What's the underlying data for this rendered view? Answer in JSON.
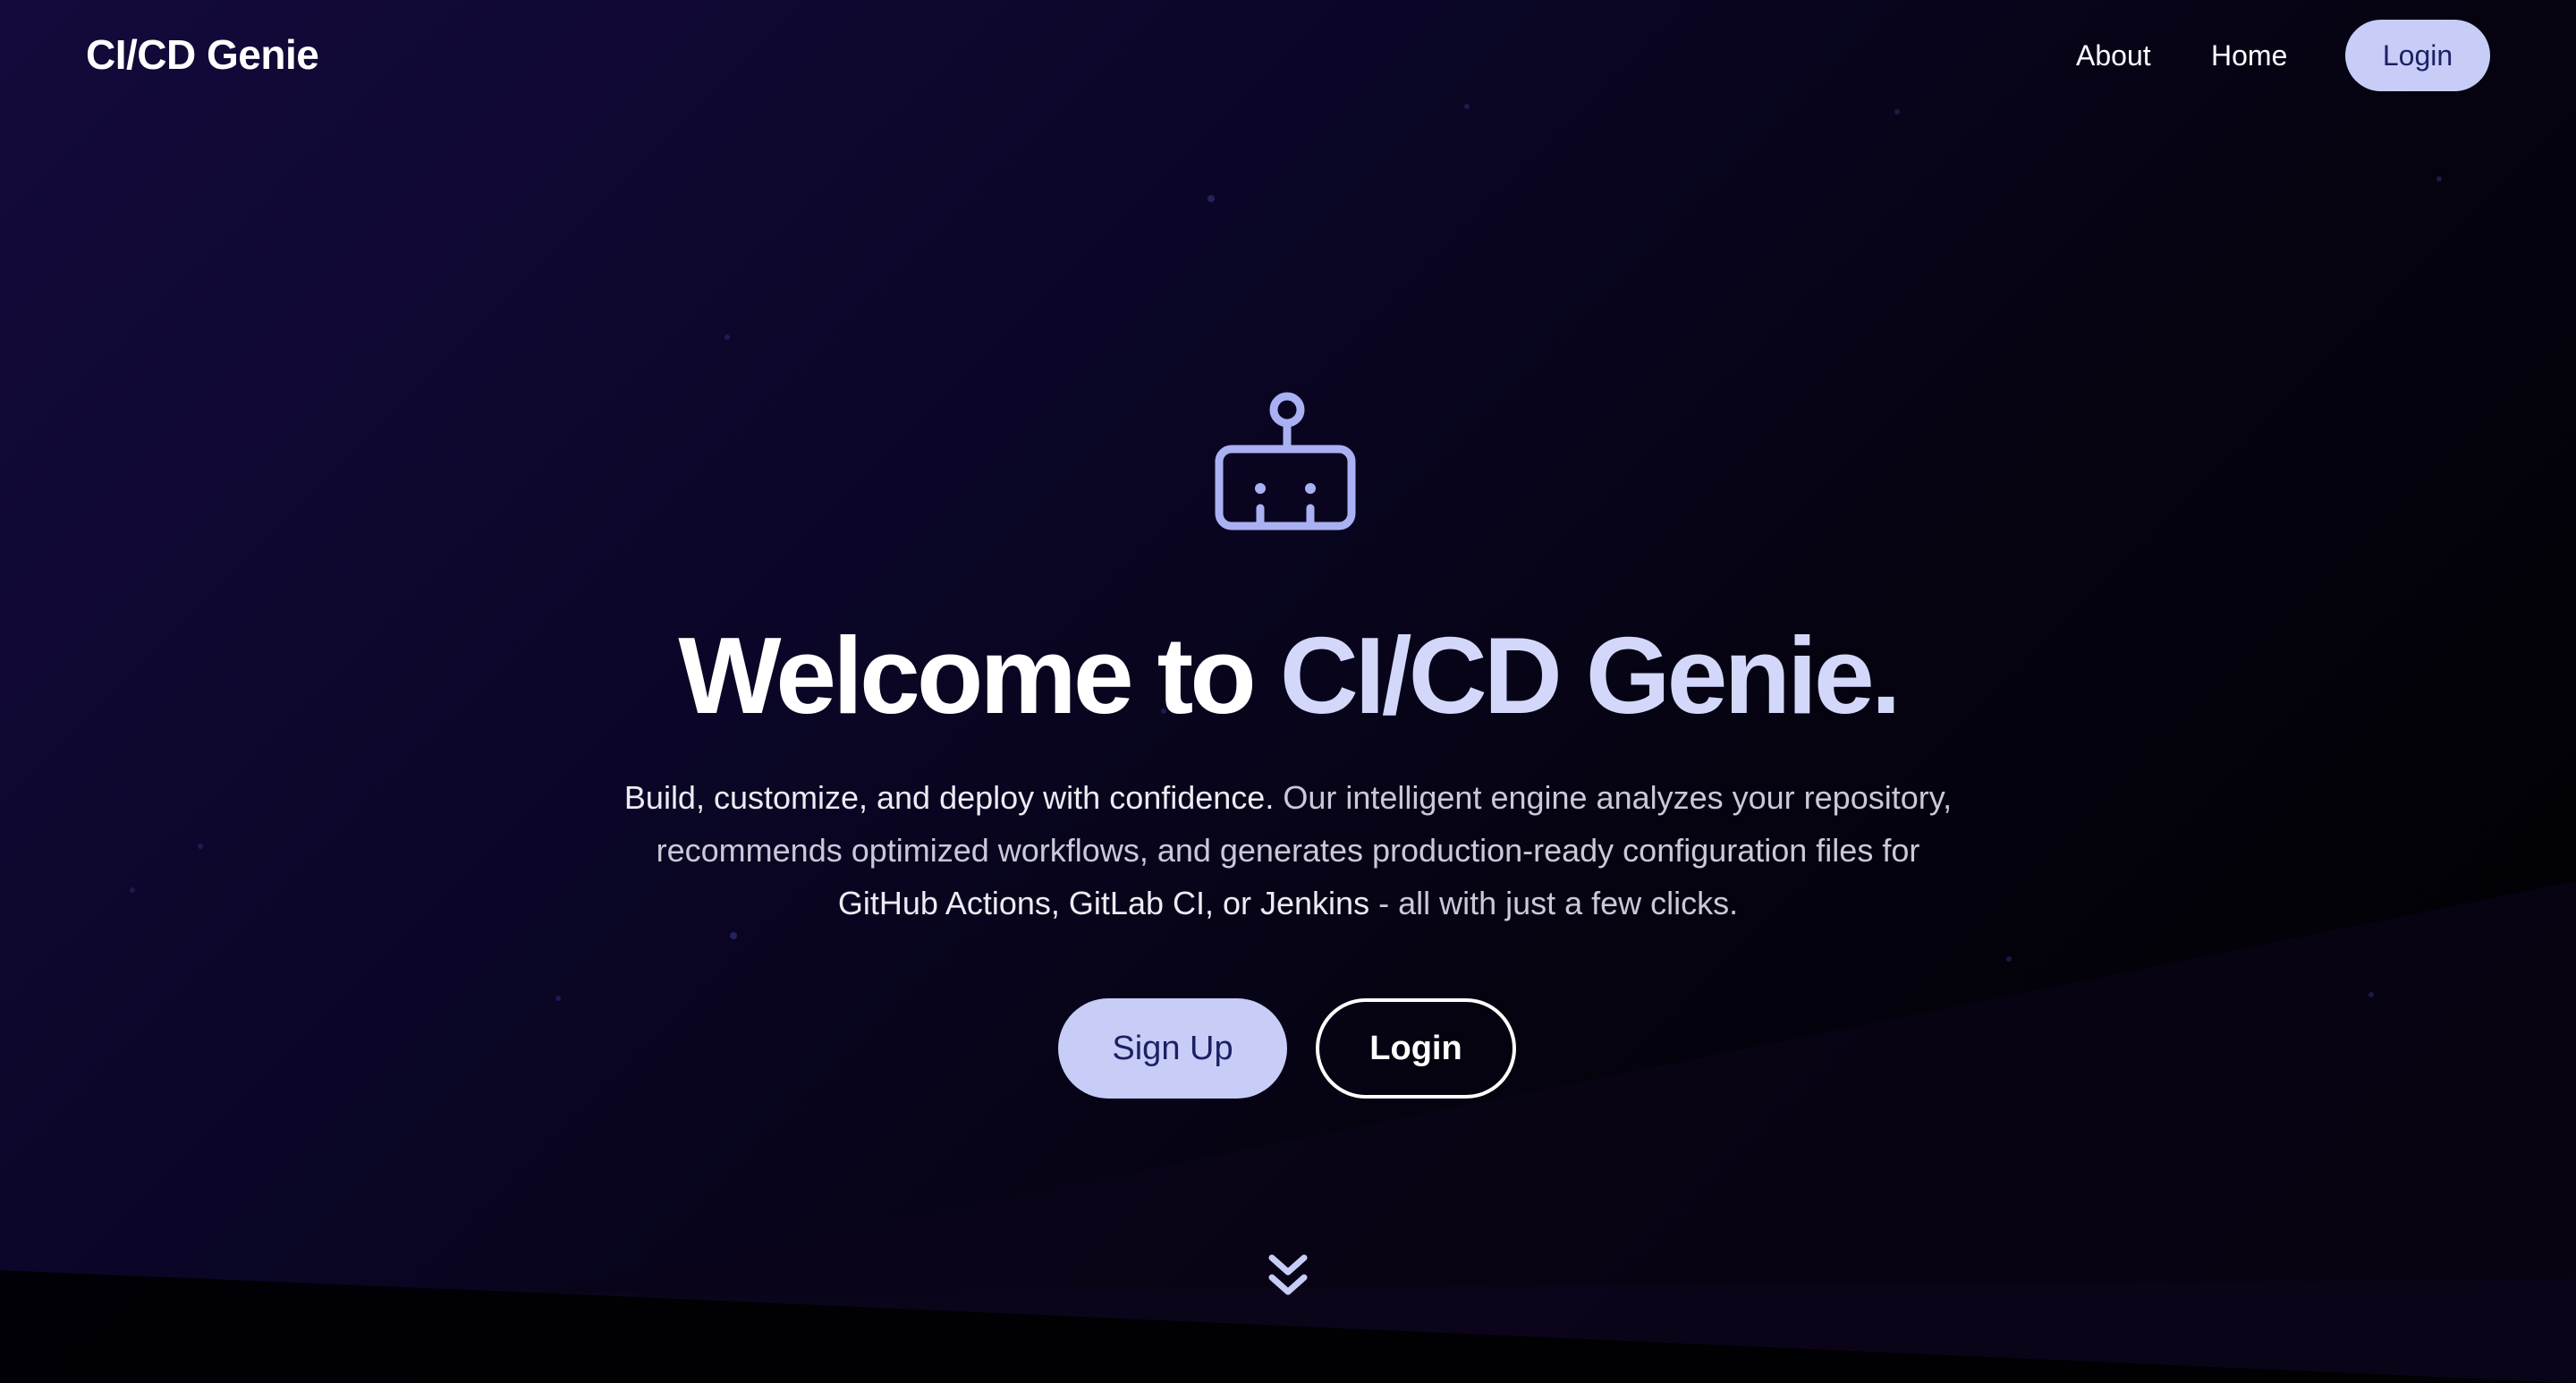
{
  "nav": {
    "brand": "CI/CD Genie",
    "links": [
      "About",
      "Home"
    ],
    "login_label": "Login"
  },
  "hero": {
    "icon": "robot-icon",
    "headline_white": "Welcome to ",
    "headline_accent": "CI/CD Genie.",
    "desc_line1_hl": "Build, customize, and deploy with confidence.",
    "desc_line1_rest": " Our intelligent engine analyzes your repository,",
    "desc_line2": "recommends optimized workflows, and generates production-ready configuration files for",
    "desc_line3_hl": "GitHub Actions, GitLab CI, or Jenkins",
    "desc_line3_rest": " - all with just a few clicks.",
    "signup_label": "Sign Up",
    "login_label": "Login",
    "scroll_icon": "double-chevron-down-icon"
  },
  "colors": {
    "accent": "#c7cdf7",
    "accent_text": "#1d1f63",
    "headline_accent": "#d3d8fb",
    "background_top": "#140a3c",
    "background_bottom": "#000000"
  }
}
